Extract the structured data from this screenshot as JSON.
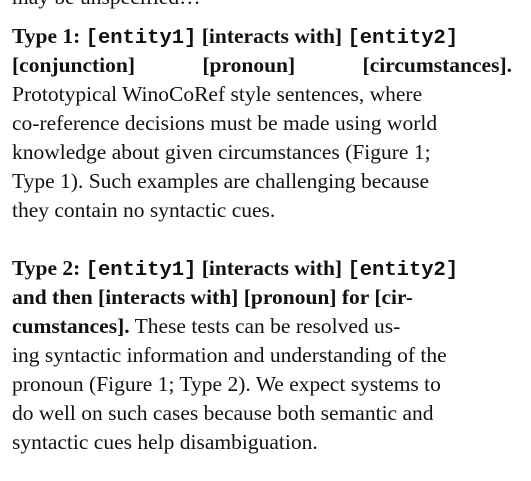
{
  "cropped_line": "may be unspecified…",
  "type1": {
    "label": "Type 1:",
    "entity1": "[entity1]",
    "interacts": "[interacts with]",
    "entity2": "[entity2]",
    "conjunction": "[conjunction]",
    "pronoun": "[pronoun]",
    "circumstances": "[circumstances].",
    "body": [
      "Prototypical WinoCoRef style sentences, where",
      "co-reference decisions must be made using world",
      "knowledge about given circumstances (Figure 1;",
      "Type 1). Such examples are challenging because",
      "they contain no syntactic cues."
    ]
  },
  "type2": {
    "label": "Type 2:",
    "entity1": "[entity1]",
    "interacts": "[interacts with]",
    "entity2": "[entity2]",
    "heading_line2": "and then [interacts with] [pronoun] for [cir-",
    "heading_line3_bold": "cumstances].",
    "heading_line3_rest": "These tests can be resolved us-",
    "body": [
      "ing syntactic information and understanding of the",
      "pronoun (Figure 1; Type 2). We expect systems to",
      "do well on such cases because both semantic and",
      "syntactic cues help disambiguation."
    ]
  }
}
